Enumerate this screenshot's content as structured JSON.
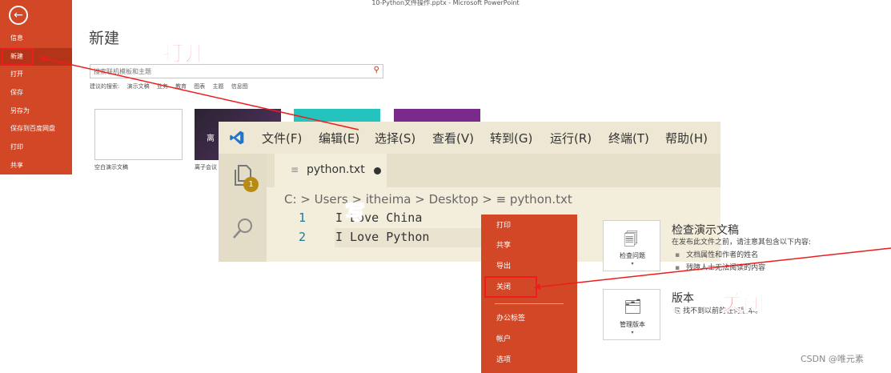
{
  "ppt_new": {
    "window_title": "10-Python文件操作.pptx - Microsoft PowerPoint",
    "back_icon": "arrow-left-icon",
    "nav": [
      "信息",
      "新建",
      "打开",
      "保存",
      "另存为",
      "保存到百度网盘",
      "打印",
      "共享"
    ],
    "heading": "新建",
    "search_placeholder": "搜索联机模板和主题",
    "suggested_label": "建议的搜索:",
    "suggested": [
      "演示文稿",
      "业务",
      "教育",
      "图表",
      "主题",
      "信息图"
    ],
    "templates": {
      "blank_label": "空白演示文稿",
      "dark_text": "离",
      "dark_label": "离子会议"
    }
  },
  "vscode": {
    "menu": [
      "文件(F)",
      "编辑(E)",
      "选择(S)",
      "查看(V)",
      "转到(G)",
      "运行(R)",
      "终端(T)",
      "帮助(H)"
    ],
    "badge": "1",
    "tab_name": "python.txt",
    "breadcrumb": "C: > Users > itheima > Desktop >  ≡  python.txt",
    "lines": [
      {
        "num": "1",
        "text": "I Love China"
      },
      {
        "num": "2",
        "text": "I Love Python"
      }
    ]
  },
  "ppt_info": {
    "nav": [
      "打印",
      "共享",
      "导出",
      "关闭",
      "办公标签",
      "帐户",
      "选项"
    ],
    "inspect": {
      "tile_label": "检查问题",
      "title": "检查演示文稿",
      "desc": "在发布此文件之前，请注意其包含以下内容:",
      "bullets": [
        "文档属性和作者的姓名",
        "残障人士无法阅读的内容"
      ]
    },
    "versions": {
      "tile_label": "管理版本",
      "title": "版本",
      "desc": "找不到以前的任何版本。"
    }
  },
  "annotations": {
    "open": "打开",
    "write": "写",
    "close": "关闭"
  },
  "watermark": "CSDN @唯元素",
  "colors": {
    "ppt_orange": "#d24726",
    "annotation_red": "#ee1c1c",
    "vscode_blue": "#1f75cb"
  }
}
